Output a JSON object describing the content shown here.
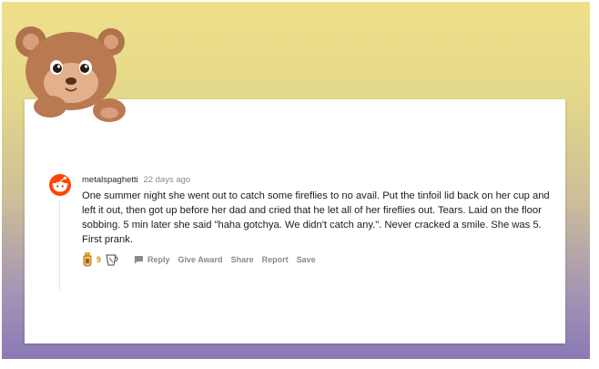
{
  "comment": {
    "username": "metalspaghetti",
    "age": "22 days ago",
    "body": "One summer night she went out to catch some fireflies to no avail. Put the tinfoil lid back on her cup and left it out, then got up before her dad and cried that he let all of her fireflies out. Tears. Laid on the floor sobbing. 5 min later she said \"haha gotchya. We didn't catch any.\". Never cracked a smile. She was 5. First prank.",
    "award_count": "9",
    "actions": {
      "reply": "Reply",
      "give_award": "Give Award",
      "share": "Share",
      "report": "Report",
      "save": "Save"
    }
  },
  "colors": {
    "background_top": "#efe08a",
    "background_bottom": "#8a79b5",
    "award_count": "#e0851f",
    "avatar": "#ff4500"
  },
  "icons": {
    "mascot": "teddy-bear-mascot",
    "avatar": "reddit-snoo-avatar",
    "award_1": "trophy-award-icon",
    "award_2": "cup-award-icon",
    "reply": "comment-bubble-icon"
  }
}
